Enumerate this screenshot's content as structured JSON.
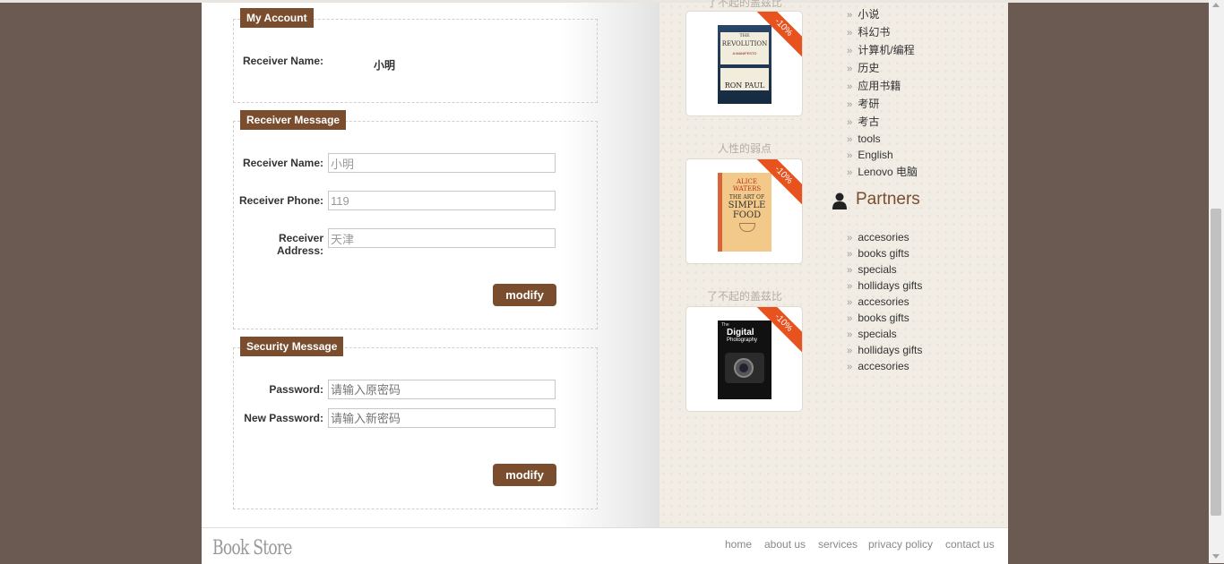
{
  "account": {
    "legend": "My Account",
    "receiver_name_label": "Receiver Name:",
    "receiver_name_value": "小明"
  },
  "receiver": {
    "legend": "Receiver Message",
    "name_label": "Receiver Name:",
    "name_value": "小明",
    "phone_label": "Receiver Phone:",
    "phone_value": "119",
    "address_label": "Receiver Address:",
    "address_value": "天津",
    "modify_label": "modify"
  },
  "security": {
    "legend": "Security Message",
    "password_label": "Password:",
    "password_placeholder": "请输入原密码",
    "new_password_label": "New Password:",
    "new_password_placeholder": "请输入新密码",
    "modify_label": "modify"
  },
  "books": [
    {
      "title": "了不起的盖兹比",
      "discount": "-10%",
      "cover": "the-revolution-cover"
    },
    {
      "title": "人性的弱点",
      "discount": "-10%",
      "cover": "simple-food-cover"
    },
    {
      "title": "了不起的盖兹比",
      "discount": "-10%",
      "cover": "digital-photography-cover"
    }
  ],
  "covers": {
    "revolution": {
      "line1": "THE",
      "line2": "REVOLUTION",
      "line3": "A MANIFESTO",
      "author": "RON PAUL"
    },
    "food": {
      "line1": "ALICE",
      "line2": "WATERS",
      "line3": "THE ART OF",
      "line4": "SIMPLE",
      "line5": "FOOD"
    },
    "photo": {
      "line1": "The",
      "line2": "Digital",
      "line3": "Photography"
    }
  },
  "categories": [
    "小说",
    "科幻书",
    "计算机/编程",
    "历史",
    "应用书籍",
    "考研",
    "考古",
    "tools",
    "English",
    "Lenovo 电脑"
  ],
  "partners": {
    "title": "Partners",
    "items": [
      "accesories",
      "books gifts",
      "specials",
      "hollidays gifts",
      "accesories",
      "books gifts",
      "specials",
      "hollidays gifts",
      "accesories"
    ]
  },
  "footer": {
    "logo": "Book Store",
    "links": [
      "home",
      "about us",
      "services",
      "privacy policy",
      "contact us"
    ]
  },
  "colors": {
    "accent": "#7a4d2f",
    "ribbon": "#e8521f",
    "background": "#6b5a51"
  }
}
